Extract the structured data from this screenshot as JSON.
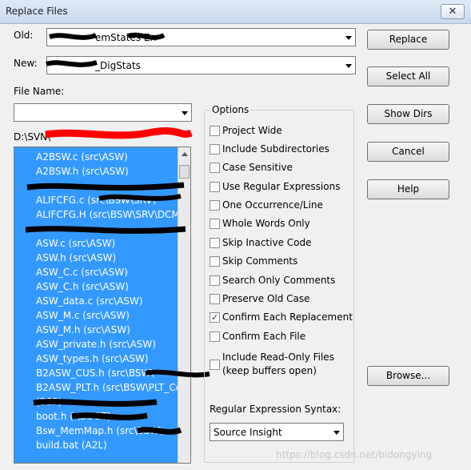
{
  "window": {
    "title": "Replace Files",
    "close_glyph": "✕"
  },
  "labels": {
    "old": "Old:",
    "new": "New:",
    "file_name": "File Name:",
    "path": "D:\\SVN\\"
  },
  "fields": {
    "old_value": "emStates        Err",
    "new_value": "_DigStats",
    "file_name_value": ""
  },
  "buttons": {
    "replace": "Replace",
    "select_all": "Select All",
    "show_dirs": "Show Dirs",
    "cancel": "Cancel",
    "help": "Help",
    "browse": "Browse..."
  },
  "file_list": [
    "A2BSW.c (src\\ASW)",
    "A2BSW.h (src\\ASW)",
    "",
    "ALIFCFG.c (src\\BSW\\SRV\\",
    "ALIFCFG.H (src\\BSW\\SRV\\DCM",
    "",
    "ASW.c (src\\ASW)",
    "ASW.h (src\\ASW)",
    "ASW_C.c (src\\ASW)",
    "ASW_C.h (src\\ASW)",
    "ASW_data.c (src\\ASW)",
    "ASW_M.c (src\\ASW)",
    "ASW_M.h (src\\ASW)",
    "ASW_private.h (src\\ASW)",
    "ASW_types.h (src\\ASW)",
    "B2ASW_CUS.h (src\\BSW\\",
    "B2ASW_PLT.h (src\\BSW\\PLT_Co",
    "                                (BSP)",
    "boot.h (            \\BOOT)",
    "Bsw_MemMap.h (src\\BSW\\",
    "build.bat (A2L)"
  ],
  "options": {
    "group_title": "Options",
    "items": [
      {
        "label": "Project Wide",
        "checked": false
      },
      {
        "label": "Include Subdirectories",
        "checked": false
      },
      {
        "label": "Case Sensitive",
        "checked": false
      },
      {
        "label": "Use Regular Expressions",
        "checked": false
      },
      {
        "label": "One Occurrence/Line",
        "checked": false
      },
      {
        "label": "Whole Words Only",
        "checked": false
      },
      {
        "label": "Skip Inactive Code",
        "checked": false
      },
      {
        "label": "Skip Comments",
        "checked": false
      },
      {
        "label": "Search Only Comments",
        "checked": false
      },
      {
        "label": "Preserve Old Case",
        "checked": false
      },
      {
        "label": "Confirm Each Replacement",
        "checked": true
      },
      {
        "label": "Confirm Each File",
        "checked": false
      },
      {
        "label": "Include Read-Only Files",
        "label2": "(keep buffers open)",
        "checked": false
      }
    ]
  },
  "regex_syntax": {
    "label": "Regular Expression Syntax:",
    "value": "Source Insight"
  },
  "watermark": "https://blog.csdn.net/bidongying",
  "colors": {
    "selection": "#3399ff",
    "redaction": "#000000",
    "path_redaction": "#ff0000"
  }
}
